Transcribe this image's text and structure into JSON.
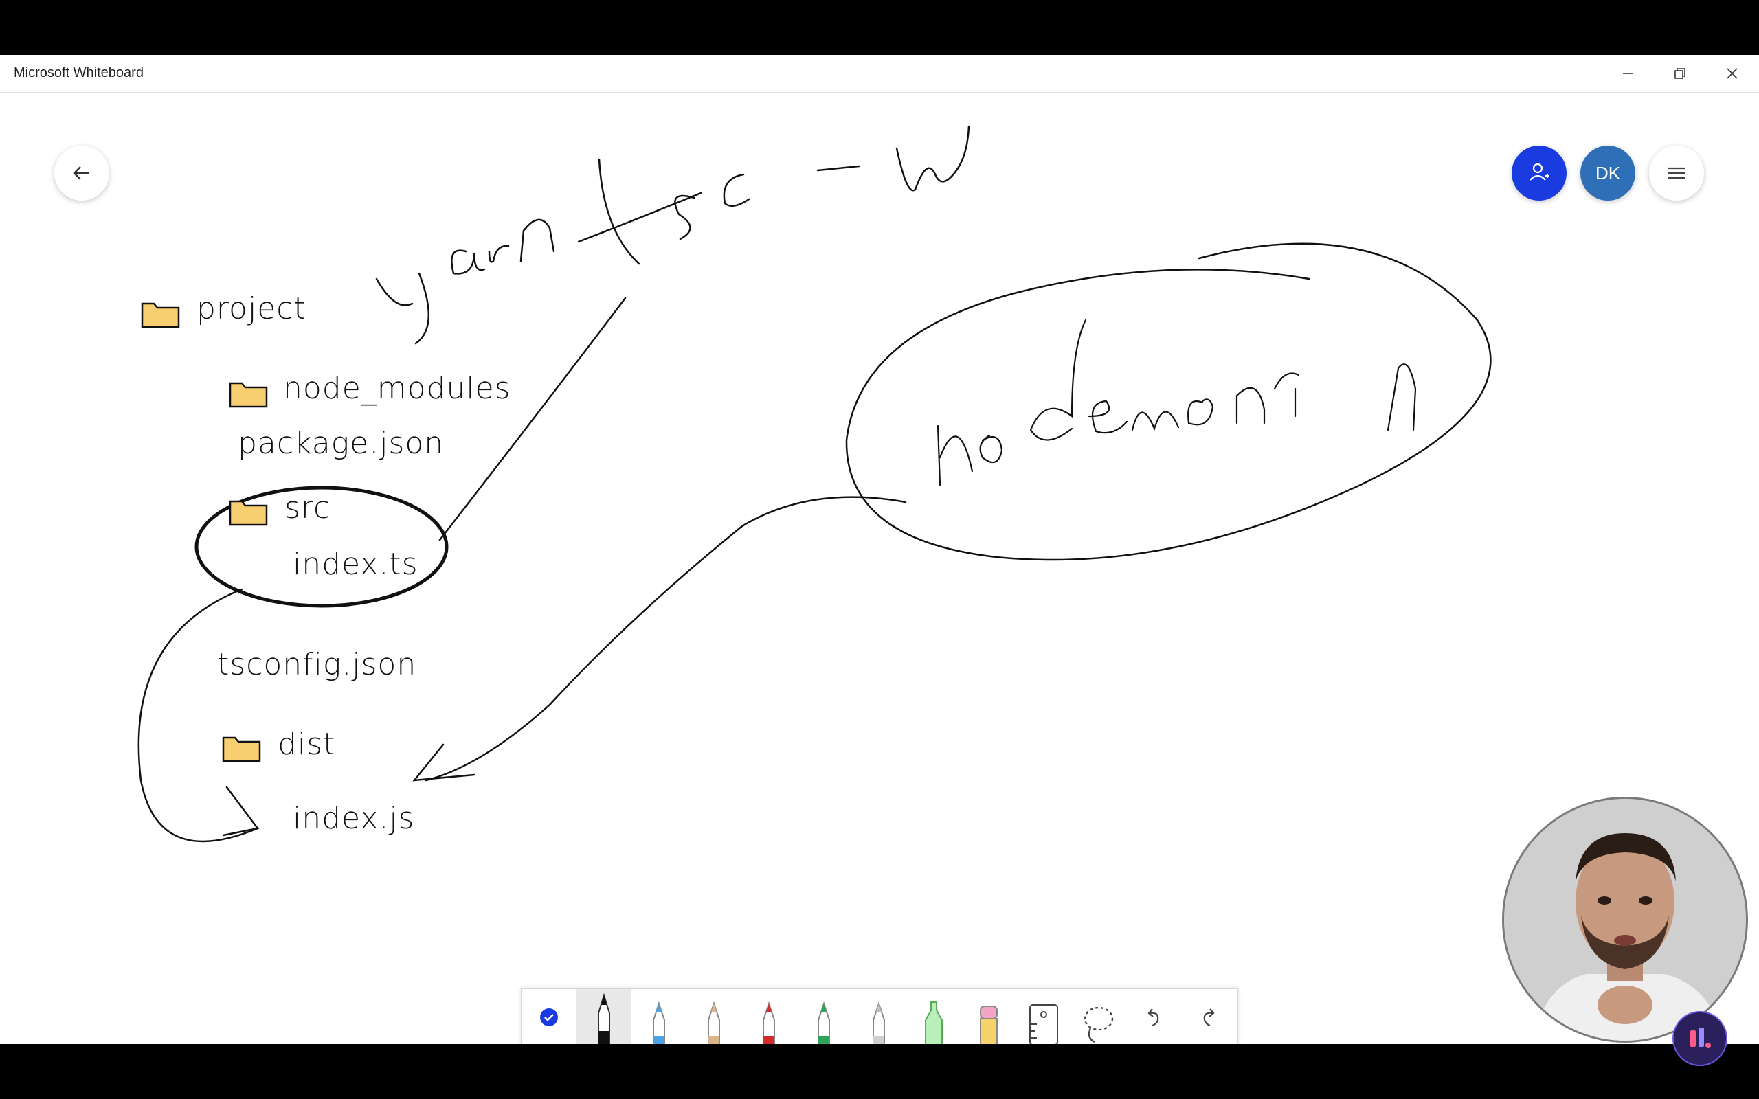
{
  "window": {
    "title": "Microsoft Whiteboard",
    "controls": {
      "minimize": "—",
      "restore": "❐",
      "close": "✕"
    }
  },
  "header": {
    "back_icon": "arrow-left-icon",
    "invite_icon": "person-add-icon",
    "avatar_initials": "DK",
    "menu_icon": "hamburger-menu-icon",
    "colors": {
      "invite": "#1a3be0",
      "avatar": "#2f6fb8"
    }
  },
  "board": {
    "handwritten_command": "yarn tsc -w",
    "nodemon_label": "nodemon",
    "tree": {
      "project": "project",
      "node_modules": "node_modules",
      "package_json": "package.json",
      "src": "src",
      "index_ts": "index.ts",
      "tsconfig": "tsconfig.json",
      "dist": "dist",
      "index_js": "index.js"
    }
  },
  "toolbar": {
    "tools": [
      {
        "name": "select-tool",
        "icon": "check-circle-icon"
      },
      {
        "name": "pen-black",
        "icon": "pen-icon",
        "color": "#111111",
        "active": true
      },
      {
        "name": "pen-blue",
        "icon": "pen-icon",
        "color": "#4ba3e3"
      },
      {
        "name": "pen-tan",
        "icon": "pen-icon",
        "color": "#d8b68a"
      },
      {
        "name": "pen-red",
        "icon": "pen-icon",
        "color": "#d42a2a"
      },
      {
        "name": "pen-green",
        "icon": "pen-icon",
        "color": "#2fa35a"
      },
      {
        "name": "pen-silver",
        "icon": "pen-icon",
        "color": "#cfcfcf"
      },
      {
        "name": "highlighter",
        "icon": "highlighter-icon",
        "color": "#9ee89e"
      },
      {
        "name": "eraser",
        "icon": "eraser-icon",
        "color": "#f3a5c7"
      },
      {
        "name": "ruler",
        "icon": "ruler-icon"
      },
      {
        "name": "lasso",
        "icon": "lasso-icon"
      },
      {
        "name": "undo",
        "icon": "undo-icon"
      },
      {
        "name": "redo",
        "icon": "redo-icon"
      }
    ]
  },
  "overlay": {
    "webcam": "presenter-webcam",
    "channel_badge_icon": "channel-logo-icon"
  }
}
